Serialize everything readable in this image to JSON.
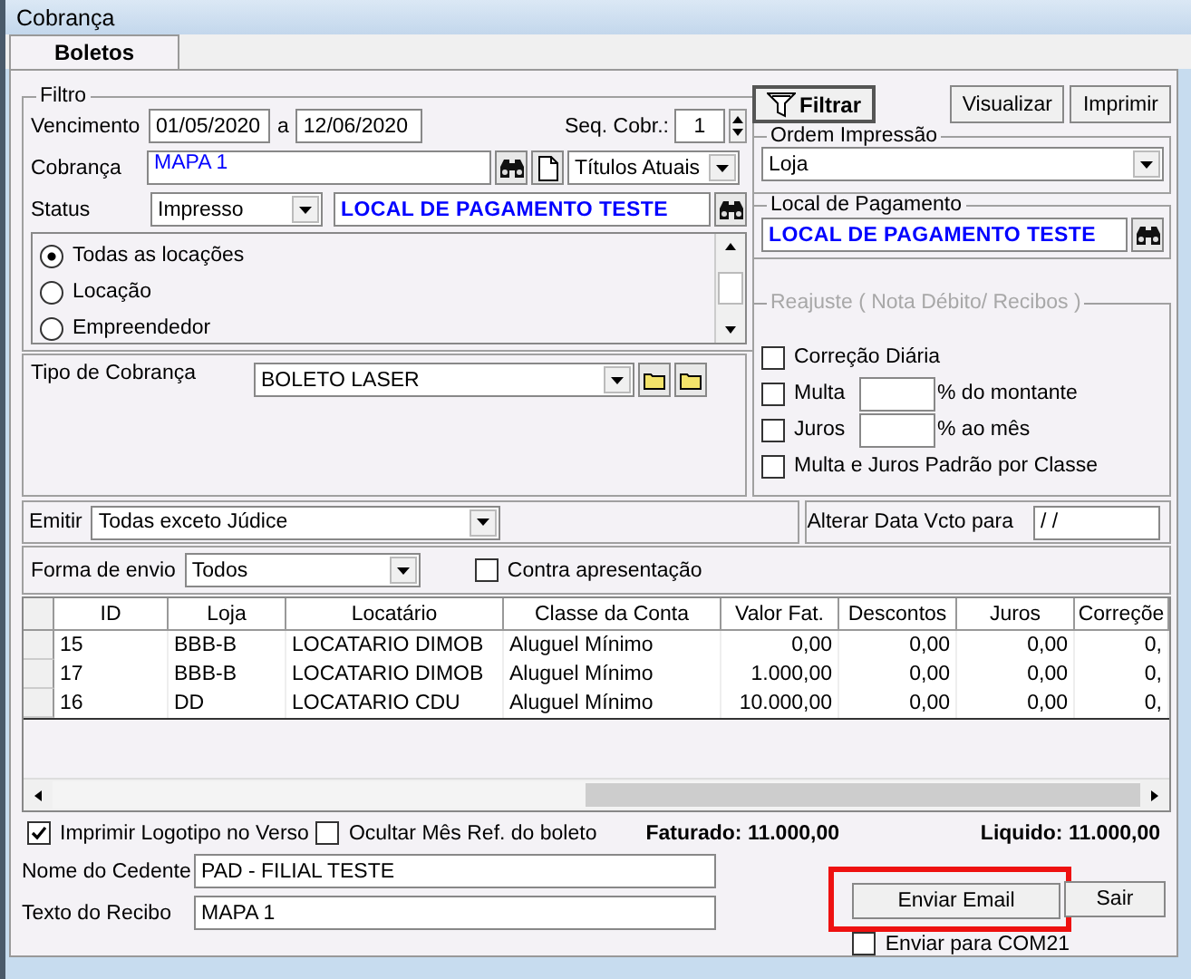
{
  "window": {
    "title": "Cobrança"
  },
  "tabs": [
    {
      "label": "Boletos",
      "selected": true
    }
  ],
  "filter": {
    "title": "Filtro",
    "due_label": "Vencimento",
    "due_from": "01/05/2020",
    "due_sep": "a",
    "due_to": "12/06/2020",
    "seq_label": "Seq. Cobr.:",
    "seq_value": "1",
    "billing_label": "Cobrança",
    "billing_value": "MAPA 1",
    "titles_value": "Títulos Atuais",
    "status_label": "Status",
    "status_value": "Impresso",
    "place_value": "LOCAL DE PAGAMENTO TESTE",
    "scope_options": [
      {
        "label": "Todas as locações",
        "selected": true
      },
      {
        "label": "Locação",
        "selected": false
      },
      {
        "label": "Empreendedor",
        "selected": false
      }
    ]
  },
  "billing_type": {
    "label": "Tipo de Cobrança",
    "value": "BOLETO LASER"
  },
  "actions": [
    {
      "label": "Filtrar",
      "kind": "filter"
    },
    {
      "label": "Visualizar",
      "kind": "plain"
    },
    {
      "label": "Imprimir",
      "kind": "plain"
    }
  ],
  "print_order": {
    "title": "Ordem Impressão",
    "value": "Loja"
  },
  "payment_place": {
    "title": "Local de Pagamento",
    "value": "LOCAL DE PAGAMENTO TESTE"
  },
  "adjustment": {
    "title": "Reajuste ( Nota Débito/ Recibos )",
    "disabled": true,
    "options": [
      {
        "label": "Correção Diária",
        "checked": false,
        "kind": "check"
      },
      {
        "label": "Multa",
        "checked": false,
        "kind": "rate",
        "suffix": "% do montante"
      },
      {
        "label": "Juros",
        "checked": false,
        "kind": "rate",
        "suffix": "% ao mês"
      },
      {
        "label": "Multa e Juros Padrão por Classe",
        "checked": false,
        "kind": "check"
      }
    ]
  },
  "emit": {
    "label": "Emitir",
    "value": "Todas exceto Júdice"
  },
  "due_change": {
    "label": "Alterar Data Vcto para",
    "value": "/ /"
  },
  "send": {
    "label": "Forma de envio",
    "value": "Todos",
    "against_label": "Contra apresentação",
    "against_checked": false
  },
  "table": {
    "columns": [
      {
        "label": "ID",
        "kind": "text"
      },
      {
        "label": "Loja",
        "kind": "text"
      },
      {
        "label": "Locatário",
        "kind": "text"
      },
      {
        "label": "Classe da Conta",
        "kind": "text"
      },
      {
        "label": "Valor Fat.",
        "kind": "number"
      },
      {
        "label": "Descontos",
        "kind": "number"
      },
      {
        "label": "Juros",
        "kind": "number"
      },
      {
        "label": "Correçõe",
        "kind": "number"
      }
    ],
    "rows": [
      [
        "15",
        "BBB-B",
        "LOCATARIO DIMOB",
        "Aluguel Mínimo",
        "0,00",
        "0,00",
        "0,00",
        "0,"
      ],
      [
        "17",
        "BBB-B",
        "LOCATARIO DIMOB",
        "Aluguel Mínimo",
        "1.000,00",
        "0,00",
        "0,00",
        "0,"
      ],
      [
        "16",
        "DD",
        "LOCATARIO CDU",
        "Aluguel Mínimo",
        "10.000,00",
        "0,00",
        "0,00",
        "0,"
      ]
    ]
  },
  "options": [
    {
      "label": "Imprimir Logotipo no Verso",
      "checked": true
    },
    {
      "label": "Ocultar Mês Ref. do boleto",
      "checked": false
    }
  ],
  "totals": [
    "Faturado: 11.000,00",
    "Liquido: 11.000,00"
  ],
  "sender": {
    "label": "Nome do Cedente",
    "value": "PAD - FILIAL TESTE"
  },
  "receipt": {
    "label": "Texto do Recibo",
    "value": "MAPA 1"
  },
  "buttons": [
    {
      "label": "Enviar Email",
      "highlighted": true
    },
    {
      "label": "Sair",
      "highlighted": false
    }
  ],
  "com21": {
    "label": "Enviar para COM21",
    "checked": false
  }
}
